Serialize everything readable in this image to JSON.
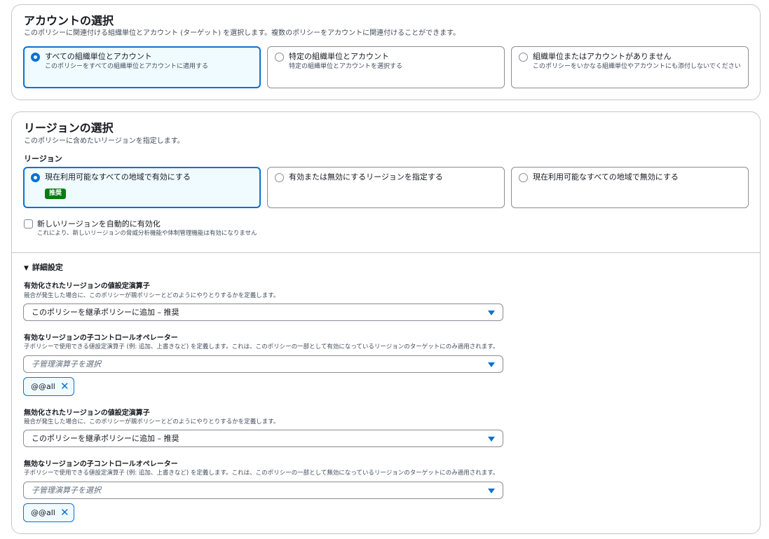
{
  "account": {
    "title": "アカウントの選択",
    "description": "このポリシーに関連付ける組織単位とアカウント (ターゲット) を選択します。複数のポリシーをアカウントに関連付けることができます。",
    "options": [
      {
        "label": "すべての組織単位とアカウント",
        "description": "このポリシーをすべての組織単位とアカウントに適用する",
        "selected": true
      },
      {
        "label": "特定の組織単位とアカウント",
        "description": "特定の組織単位とアカウントを選択する",
        "selected": false
      },
      {
        "label": "組織単位またはアカウントがありません",
        "description": "このポリシーをいかなる組織単位やアカウントにも添付しないでください",
        "selected": false
      }
    ]
  },
  "region": {
    "title": "リージョンの選択",
    "description": "このポリシーに含めたいリージョンを指定します。",
    "field_label": "リージョン",
    "options": [
      {
        "label": "現在利用可能なすべての地域で有効にする",
        "badge": "推奨",
        "selected": true
      },
      {
        "label": "有効または無効にするリージョンを指定する",
        "selected": false
      },
      {
        "label": "現在利用可能なすべての地域で無効にする",
        "selected": false
      }
    ],
    "auto_enable": {
      "label": "新しいリージョンを自動的に有効化",
      "description": "これにより、新しいリージョンの脅威分析機能や体制管理機能は有効になりません",
      "checked": false
    }
  },
  "advanced": {
    "title": "詳細設定",
    "fields": [
      {
        "label": "有効化されたリージョンの値設定演算子",
        "description": "競合が発生した場合に、このポリシーが親ポリシーとどのようにやりとりするかを定義します。",
        "value": "このポリシーを継承ポリシーに追加 – 推奨"
      },
      {
        "label": "有効なリージョンの子コントロールオペレーター",
        "description": "子ポリシーで使用できる値設定演算子 (例: 追加、上書きなど) を定義します。これは、このポリシーの一部として有効になっているリージョンのターゲットにのみ適用されます。",
        "placeholder": "子管理演算子を選択",
        "token": "@@all"
      },
      {
        "label": "無効化されたリージョンの値設定演算子",
        "description": "競合が発生した場合に、このポリシーが親ポリシーとどのようにやりとりするかを定義します。",
        "value": "このポリシーを継承ポリシーに追加 – 推奨"
      },
      {
        "label": "無効なリージョンの子コントロールオペレーター",
        "description": "子ポリシーで使用できる値設定演算子 (例: 追加、上書きなど) を定義します。これは、このポリシーの一部として無効になっているリージョンのターゲットにのみ適用されます。",
        "placeholder": "子管理演算子を選択",
        "token": "@@all"
      }
    ]
  },
  "colors": {
    "accent": "#0972d3",
    "badge": "#037f0c",
    "border": "#8c8c94"
  }
}
